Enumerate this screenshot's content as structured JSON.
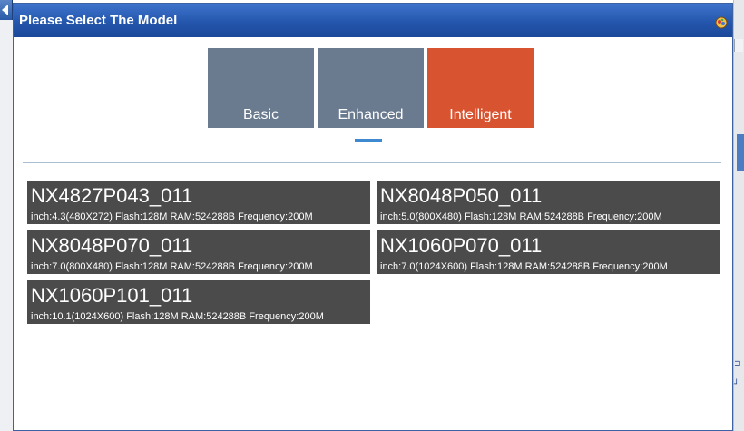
{
  "dialog": {
    "title": "Please Select The Model",
    "icon": "app-icon"
  },
  "tabs": [
    {
      "label": "Basic",
      "active": false
    },
    {
      "label": "Enhanced",
      "active": false
    },
    {
      "label": "Intelligent",
      "active": true
    }
  ],
  "colors": {
    "tab_inactive": "#6a7a8f",
    "tab_active": "#d85431",
    "card_bg": "#4b4b4b",
    "indicator": "#3e89d0",
    "titlebar": "#2456ad"
  },
  "models": [
    {
      "name": "NX4827P043_011",
      "spec": "inch:4.3(480X272) Flash:128M RAM:524288B Frequency:200M"
    },
    {
      "name": "NX8048P050_011",
      "spec": "inch:5.0(800X480) Flash:128M RAM:524288B Frequency:200M"
    },
    {
      "name": "NX8048P070_011",
      "spec": "inch:7.0(800X480) Flash:128M RAM:524288B Frequency:200M"
    },
    {
      "name": "NX1060P070_011",
      "spec": "inch:7.0(1024X600) Flash:128M RAM:524288B Frequency:200M"
    },
    {
      "name": "NX1060P101_011",
      "spec": "inch:10.1(1024X600) Flash:128M RAM:524288B Frequency:200M"
    }
  ]
}
